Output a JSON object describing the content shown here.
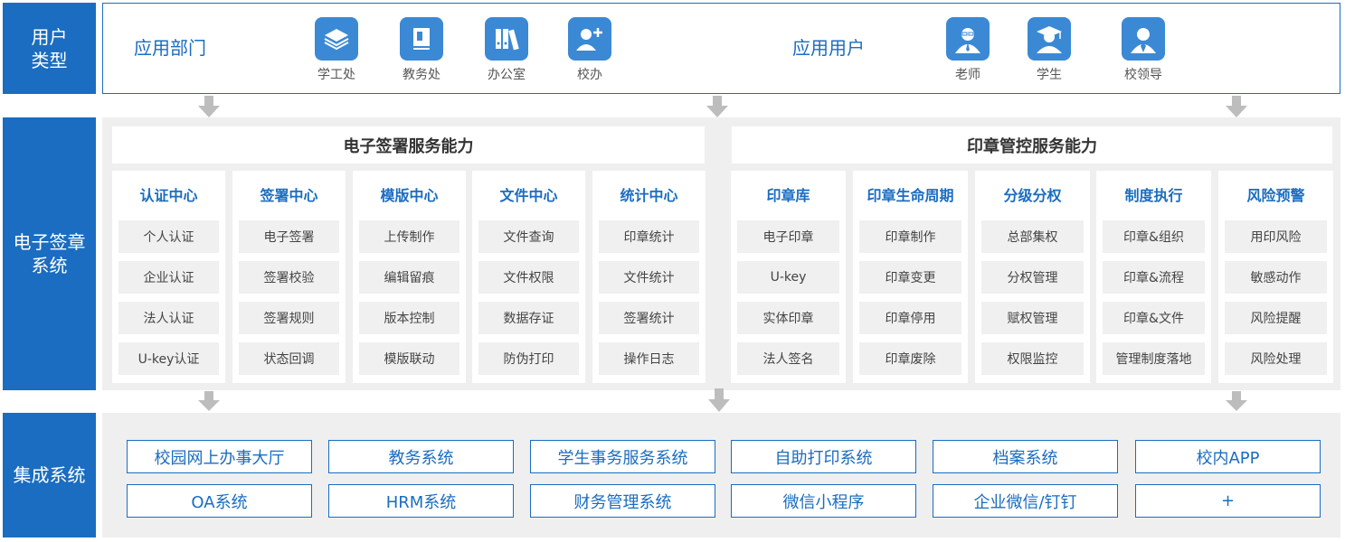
{
  "side_labels": {
    "user_type": [
      "用户",
      "类型"
    ],
    "esign_system": [
      "电子签章",
      "系统"
    ],
    "integration": [
      "集成系统"
    ]
  },
  "user_section": {
    "departments_label": "应用部门",
    "departments": [
      {
        "label": "学工处",
        "icon": "layers-icon"
      },
      {
        "label": "教务处",
        "icon": "book-icon"
      },
      {
        "label": "办公室",
        "icon": "binders-icon"
      },
      {
        "label": "校办",
        "icon": "user-add-icon"
      }
    ],
    "users_label": "应用用户",
    "users": [
      {
        "label": "老师",
        "icon": "teacher-icon"
      },
      {
        "label": "学生",
        "icon": "student-icon"
      },
      {
        "label": "校领导",
        "icon": "leader-icon"
      }
    ]
  },
  "esign_panel": {
    "title": "电子签署服务能力",
    "columns": [
      {
        "header": "认证中心",
        "items": [
          "个人认证",
          "企业认证",
          "法人认证",
          "U-key认证"
        ]
      },
      {
        "header": "签署中心",
        "items": [
          "电子签署",
          "签署校验",
          "签署规则",
          "状态回调"
        ]
      },
      {
        "header": "模版中心",
        "items": [
          "上传制作",
          "编辑留痕",
          "版本控制",
          "模版联动"
        ]
      },
      {
        "header": "文件中心",
        "items": [
          "文件查询",
          "文件权限",
          "数据存证",
          "防伪打印"
        ]
      },
      {
        "header": "统计中心",
        "items": [
          "印章统计",
          "文件统计",
          "签署统计",
          "操作日志"
        ]
      }
    ]
  },
  "seal_panel": {
    "title": "印章管控服务能力",
    "columns": [
      {
        "header": "印章库",
        "items": [
          "电子印章",
          "U-key",
          "实体印章",
          "法人签名"
        ]
      },
      {
        "header": "印章生命周期",
        "items": [
          "印章制作",
          "印章变更",
          "印章停用",
          "印章废除"
        ]
      },
      {
        "header": "分级分权",
        "items": [
          "总部集权",
          "分权管理",
          "赋权管理",
          "权限监控"
        ]
      },
      {
        "header": "制度执行",
        "items": [
          "印章&组织",
          "印章&流程",
          "印章&文件",
          "管理制度落地"
        ]
      },
      {
        "header": "风险预警",
        "items": [
          "用印风险",
          "敏感动作",
          "风险提醒",
          "风险处理"
        ]
      }
    ]
  },
  "integration_systems": [
    [
      "校园网上办事大厅",
      "教务系统",
      "学生事务服务系统",
      "自助打印系统",
      "档案系统",
      "校内APP"
    ],
    [
      "OA系统",
      "HRM系统",
      "财务管理系统",
      "微信小程序",
      "企业微信/钉钉",
      "+"
    ]
  ],
  "colors": {
    "brand_blue": "#1a6dc1",
    "icon_blue": "#3b89d4",
    "panel_bg": "#efefef",
    "cell_bg": "#f0f0f0",
    "arrow_gray": "#bdbdbd"
  }
}
